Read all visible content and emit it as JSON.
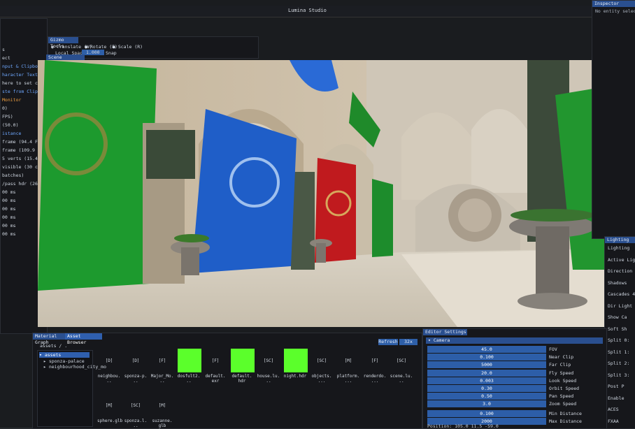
{
  "window": {
    "title": "Lumina Studio"
  },
  "gizmo": {
    "title": "Gizmo Tools",
    "modes": [
      "Translate (W)",
      "Rotate (E)",
      "Scale (R)"
    ],
    "local_space": "Local Space",
    "snap_value": "1.000",
    "snap_label": "Snap"
  },
  "viewport": {
    "title": "Scene Viewport"
  },
  "inspector": {
    "title": "Inspector",
    "empty": "No entity selected"
  },
  "left": {
    "lines": [
      "s",
      "ect",
      "nput & Clipboard",
      "haracter Text Input",
      "here to set character",
      "ste from Clipboard",
      "Monitor",
      "0)",
      "FPS)",
      "(50.0)",
      "istance",
      "frame (94.4 FPS)",
      "frame (109.9 FPS)",
      "5 verts (15.4K)",
      "visible (30 culled)",
      "batches)",
      "/pass hdr (26.6%)",
      "00 ms",
      "00 ms",
      "00 ms",
      "00 ms",
      "00 ms",
      "00 ms"
    ]
  },
  "bottom_left": {
    "tabs": [
      "Material Graph",
      "Asset Browser"
    ],
    "path": "assets / .",
    "refresh": "Refresh",
    "size_btn": "32x",
    "tree": [
      "assets",
      "sponza-palace",
      "neighbourhood_city_mo"
    ],
    "assets_row1": [
      {
        "tag": "[D]",
        "name": "neighbou.\n.."
      },
      {
        "tag": "[D]",
        "name": "sponza-p.\n.."
      },
      {
        "tag": "[F]",
        "name": "Major_Mo.\n.."
      },
      {
        "tag": "",
        "name": "dosfult2.\n..",
        "thumb": true
      },
      {
        "tag": "[F]",
        "name": "default.\nexr"
      },
      {
        "tag": "",
        "name": "default.\nhdr",
        "thumb": true
      },
      {
        "tag": "[SC]",
        "name": "house.lu.\n.."
      },
      {
        "tag": "",
        "name": "night.hdr",
        "thumb": true
      },
      {
        "tag": "[SC]",
        "name": "objects.\n..."
      },
      {
        "tag": "[M]",
        "name": "platform.\n..."
      },
      {
        "tag": "[F]",
        "name": "renderdo.\n..."
      },
      {
        "tag": "[SC]",
        "name": "scene.lu.\n.."
      }
    ],
    "assets_row2": [
      {
        "tag": "[M]",
        "name": "sphere.glb"
      },
      {
        "tag": "[SC]",
        "name": "sponza.l.\n.."
      },
      {
        "tag": "[M]",
        "name": "suzanne.\nglb"
      }
    ]
  },
  "editor_settings": {
    "title": "Editor Settings",
    "section": "Camera",
    "rows": [
      {
        "value": "45.0",
        "label": "FOV"
      },
      {
        "value": "0.100",
        "label": "Near Clip"
      },
      {
        "value": "5000",
        "label": "Far Clip"
      },
      {
        "value": "20.0",
        "label": "Fly Speed"
      },
      {
        "value": "0.003",
        "label": "Look Speed"
      },
      {
        "value": "0.30",
        "label": "Orbit Speed"
      },
      {
        "value": "0.50",
        "label": "Pan Speed"
      },
      {
        "value": "3.0",
        "label": "Zoom Speed"
      },
      {
        "value": "0.100",
        "label": "Min Distance"
      },
      {
        "value": "2000",
        "label": "Max Distance"
      }
    ],
    "position": "Position: 105.0  11.5  -59.0"
  },
  "lighting": {
    "title": "Lighting",
    "lines": [
      "Lighting",
      "Active Light",
      "Direction",
      "Shadows",
      "Cascades 4",
      "Dir Light (",
      "Show Ca",
      "Soft Sh",
      "Split 0:",
      "Split 1:",
      "Split 2:",
      "Split 3:",
      "Post P",
      "Enable",
      "ACES",
      "FXAA"
    ]
  },
  "colors": {
    "accent": "#2e5fa8",
    "thumb": "#5bff2b",
    "highlight": "#f0a040"
  }
}
